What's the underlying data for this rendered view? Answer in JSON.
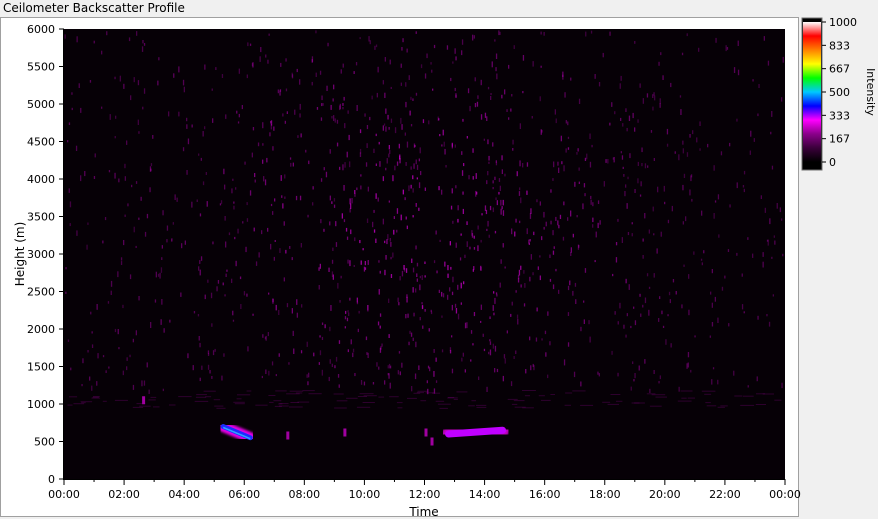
{
  "window": {
    "title": "Ceilometer Backscatter Profile"
  },
  "chart_data": {
    "type": "heatmap",
    "title": "Ceilometer Backscatter Profile",
    "xlabel": "Time",
    "ylabel": "Height (m)",
    "x_ticks": [
      "00:00",
      "02:00",
      "04:00",
      "06:00",
      "08:00",
      "10:00",
      "12:00",
      "14:00",
      "16:00",
      "18:00",
      "20:00",
      "22:00",
      "00:00"
    ],
    "x_range_hours": [
      0,
      24
    ],
    "y_ticks": [
      0,
      500,
      1000,
      1500,
      2000,
      2500,
      3000,
      3500,
      4000,
      4500,
      5000,
      5500,
      6000
    ],
    "ylim": [
      0,
      6000
    ],
    "colorbar": {
      "label": "Intensity",
      "range": [
        0,
        1000
      ],
      "ticks": [
        "0",
        "167",
        "333",
        "500",
        "667",
        "833",
        "1000"
      ],
      "colors": [
        "#000000",
        "#3a003a",
        "#8a008a",
        "#ff00ff",
        "#0000ff",
        "#00c8ff",
        "#00ff00",
        "#ffff00",
        "#ff8000",
        "#ff0000",
        "#ffffff"
      ]
    },
    "features": [
      {
        "name": "cloud-layer-1",
        "t_start": 5.3,
        "t_end": 6.2,
        "height_start": 700,
        "height_end": 550,
        "intensity": 450
      },
      {
        "name": "cloud-layer-2",
        "t_start": 12.8,
        "t_end": 14.6,
        "height_start": 600,
        "height_end": 650,
        "intensity": 250
      }
    ],
    "grid": false
  }
}
